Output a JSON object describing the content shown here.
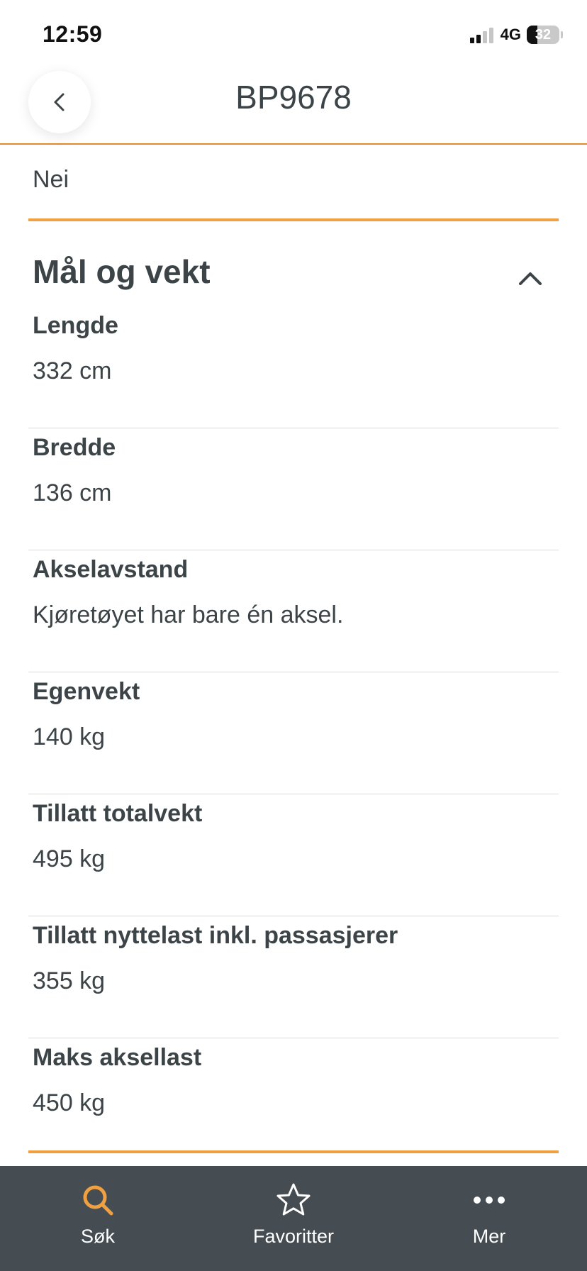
{
  "status_bar": {
    "time": "12:59",
    "network": "4G",
    "battery": "32",
    "battery_level": 0.32
  },
  "header": {
    "title": "BP9678",
    "back_icon": "chevron-left-icon"
  },
  "previous_section": {
    "last_value": "Nei"
  },
  "section": {
    "title": "Mål og vekt",
    "toggle_icon": "chevron-up-icon",
    "fields": [
      {
        "label": "Lengde",
        "value": "332 cm"
      },
      {
        "label": "Bredde",
        "value": "136 cm"
      },
      {
        "label": "Akselavstand",
        "value": "Kjøretøyet har bare én aksel."
      },
      {
        "label": "Egenvekt",
        "value": "140 kg"
      },
      {
        "label": "Tillatt totalvekt",
        "value": "495 kg"
      },
      {
        "label": "Tillatt nyttelast inkl. passasjerer",
        "value": "355 kg"
      },
      {
        "label": "Maks aksellast",
        "value": "450 kg"
      }
    ]
  },
  "nav": {
    "items": [
      {
        "label": "Søk",
        "icon": "search-icon",
        "active": true
      },
      {
        "label": "Favoritter",
        "icon": "star-icon",
        "active": false
      },
      {
        "label": "Mer",
        "icon": "more-icon",
        "active": false
      }
    ]
  },
  "colors": {
    "accent": "#f0a040",
    "text": "#3c4448",
    "nav_background": "#454d52",
    "divider": "#d9dcde"
  }
}
